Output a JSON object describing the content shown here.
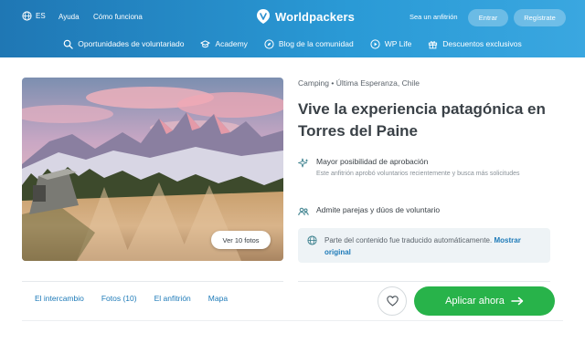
{
  "header": {
    "language": "ES",
    "top_links": [
      "Ayuda",
      "Cómo funciona"
    ],
    "logo_text": "Worldpackers",
    "host_link": "Sea un anfitrión",
    "login_label": "Entrar",
    "signup_label": "Regístrate",
    "menu": [
      {
        "label": "Oportunidades de voluntariado",
        "icon": "search-icon"
      },
      {
        "label": "Academy",
        "icon": "graduation-cap-icon"
      },
      {
        "label": "Blog de la comunidad",
        "icon": "compass-icon"
      },
      {
        "label": "WP Life",
        "icon": "play-icon"
      },
      {
        "label": "Descuentos exclusivos",
        "icon": "gift-icon"
      }
    ]
  },
  "listing": {
    "category": "Camping",
    "separator": "•",
    "location": "Última Esperanza, Chile",
    "title": "Vive la experiencia patagónica en Torres del Paine",
    "photos_button": "Ver 10 fotos",
    "features": [
      {
        "title": "Mayor posibilidad de aprobación",
        "description": "Este anfitrión aprobó voluntarios recientemente y busca más solicitudes",
        "icon": "sparkle-icon"
      },
      {
        "title": "Admite parejas y dúos de voluntario",
        "description": "",
        "icon": "people-icon"
      }
    ],
    "notice": {
      "text": "Parte del contenido fue traducido automáticamente.",
      "link": "Mostrar original",
      "icon": "globe-icon"
    }
  },
  "tabs": [
    "El intercambio",
    "Fotos (10)",
    "El anfitrión",
    "Mapa"
  ],
  "actions": {
    "apply_label": "Aplicar ahora",
    "favorite_icon": "heart-icon",
    "apply_icon": "arrow-right-icon"
  },
  "colors": {
    "header": "#2a8fcf",
    "accent_link": "#1d7ab8",
    "apply_button": "#28b34a"
  }
}
